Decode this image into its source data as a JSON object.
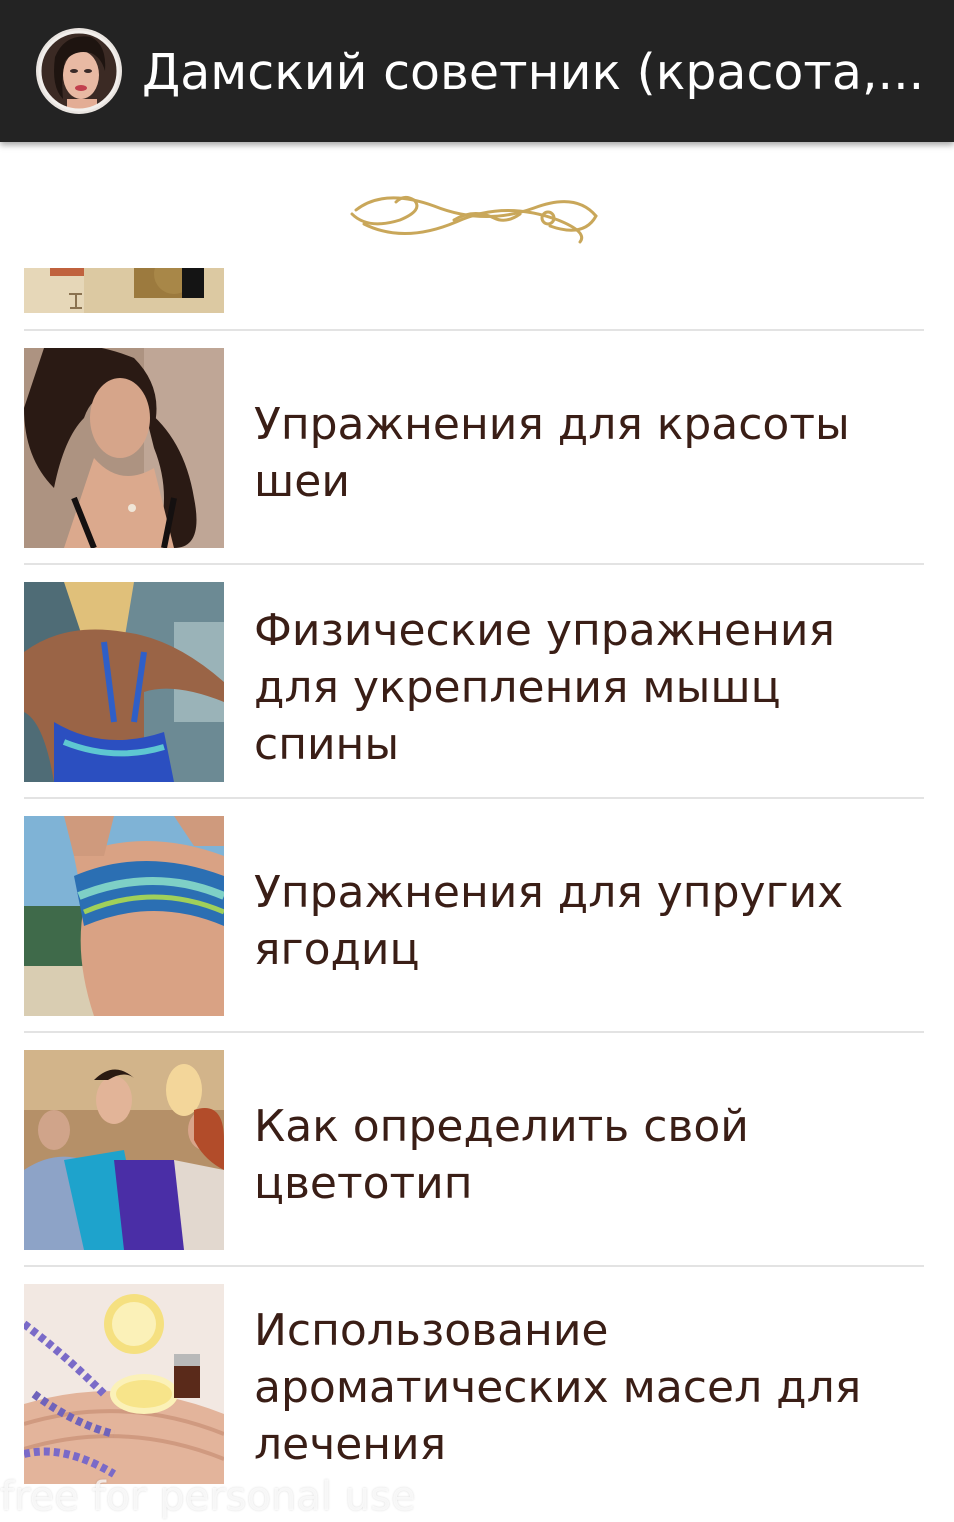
{
  "app_bar": {
    "title": "Дамский советник (красота,...",
    "icon": "app-avatar-icon",
    "background_color": "#232323"
  },
  "header_ornament": "gold-flourish-icon",
  "articles": [
    {
      "title": "",
      "image": "partial-thumbnail"
    },
    {
      "title": "Упражнения для красоты шеи",
      "image": "woman-neck-photo"
    },
    {
      "title": "Физические упражнения для укрепления мышц спины",
      "image": "woman-back-photo"
    },
    {
      "title": "Упражнения для упругих ягодиц",
      "image": "glutes-beach-photo"
    },
    {
      "title": "Как определить свой цветотип",
      "image": "color-fabrics-photo"
    },
    {
      "title": "Использование ароматических масел для лечения",
      "image": "lemon-lavender-photo"
    }
  ],
  "watermark": "free for personal use",
  "colors": {
    "title_text": "#3a1e16",
    "divider": "#e3e3e3",
    "ornament_gold": "#c9a75a"
  }
}
